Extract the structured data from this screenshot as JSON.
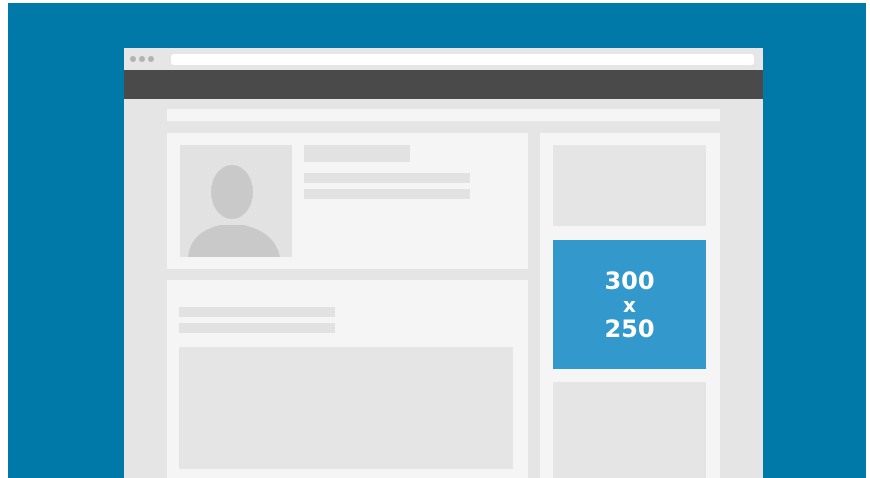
{
  "ad": {
    "width_label": "300",
    "separator_label": "x",
    "height_label": "250",
    "color": "#3399cc"
  },
  "colors": {
    "background": "#0079a8",
    "nav_bar": "#4a4a4a",
    "card": "#f5f5f5",
    "placeholder": "#e2e2e2"
  },
  "icons": {
    "avatar": "person-silhouette-icon",
    "window_controls": "traffic-light-dots-icon"
  }
}
